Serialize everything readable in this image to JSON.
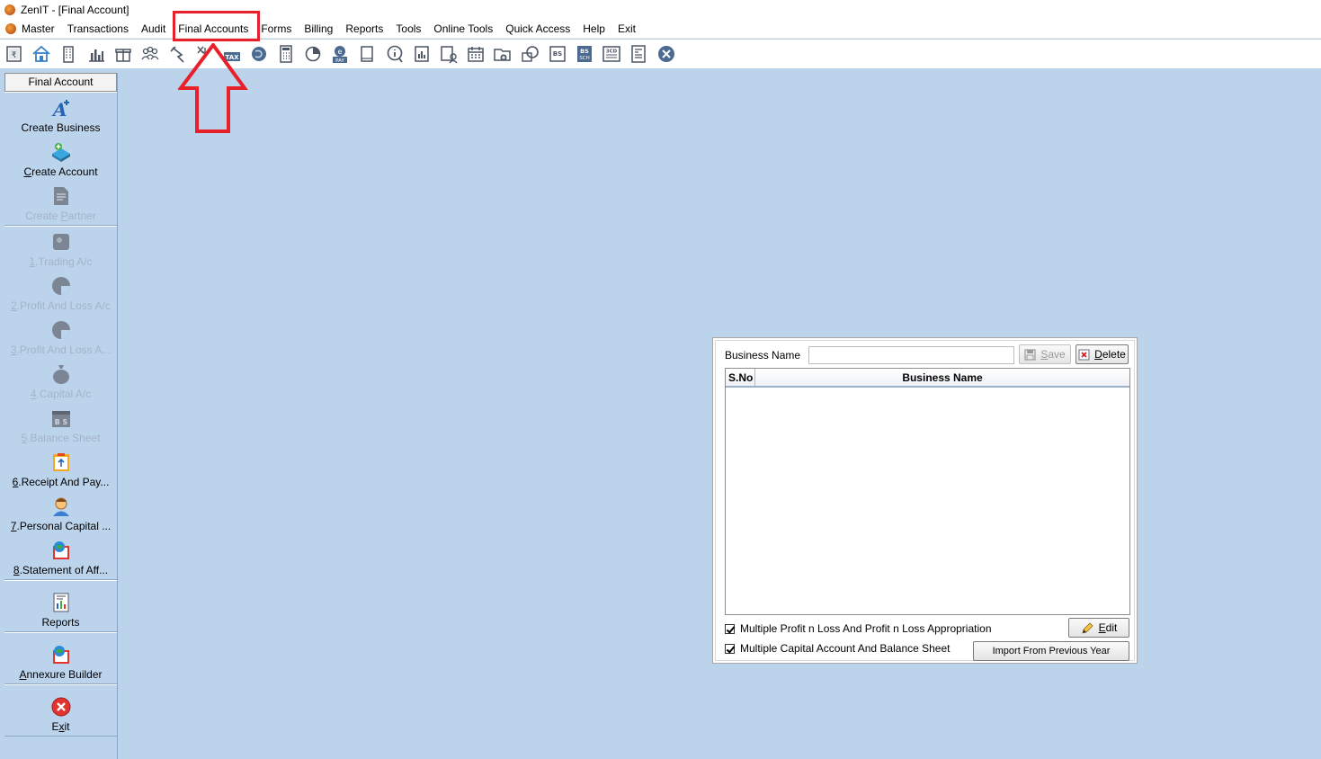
{
  "window": {
    "title": "ZenIT - [Final Account]"
  },
  "menu": {
    "items": [
      "Master",
      "Transactions",
      "Audit",
      "Final Accounts",
      "Forms",
      "Billing",
      "Reports",
      "Tools",
      "Online Tools",
      "Quick Access",
      "Help",
      "Exit"
    ],
    "highlighted": "Final Accounts"
  },
  "toolbar": {
    "icons": [
      "rupee-book-icon",
      "home-icon",
      "building-icon",
      "bar-chart-icon",
      "gift-icon",
      "group-icon",
      "pin-icon",
      "tax-icon",
      "tax-doc-icon",
      "audit-disc-icon",
      "calculator-icon",
      "pie-icon",
      "epay-icon",
      "book-icon",
      "info-icon",
      "report-icon",
      "user-report-icon",
      "calendar-icon",
      "folder-add-icon",
      "refresh-icon",
      "bs-icon",
      "bs-sch-icon",
      "3cd-icon",
      "form-icon",
      "close-circle-icon"
    ],
    "labels": {
      "tax": "TAX",
      "pay": "PAY",
      "bs": "BS",
      "sch": "SCH",
      "cd": "3CD"
    }
  },
  "sidebar": {
    "header": "Final Account",
    "groups": [
      [
        {
          "pre": "",
          "ul": "",
          "post": "Create Business",
          "icon": "create-business-icon",
          "enabled": true
        },
        {
          "pre": "",
          "ul": "C",
          "post": "reate Account",
          "icon": "create-account-icon",
          "enabled": true
        },
        {
          "pre": "Create ",
          "ul": "P",
          "post": "artner",
          "icon": "create-partner-icon",
          "enabled": false
        }
      ],
      [
        {
          "pre": "",
          "ul": "1",
          "post": ".Trading A/c",
          "icon": "trading-icon",
          "enabled": false
        },
        {
          "pre": "",
          "ul": "2",
          "post": ".Profit And Loss A/c",
          "icon": "profit-loss-icon",
          "enabled": false
        },
        {
          "pre": "",
          "ul": "3",
          "post": ".Profit And Loss A...",
          "icon": "profit-loss-appropriation-icon",
          "enabled": false
        },
        {
          "pre": "",
          "ul": "4",
          "post": ".Capital A/c",
          "icon": "capital-bag-icon",
          "enabled": false
        },
        {
          "pre": "",
          "ul": "5",
          "post": ".Balance Sheet",
          "icon": "balance-sheet-icon",
          "enabled": false
        },
        {
          "pre": "",
          "ul": "6",
          "post": ".Receipt And Pay...",
          "icon": "receipt-payment-icon",
          "enabled": true
        },
        {
          "pre": "",
          "ul": "7",
          "post": ".Personal Capital ...",
          "icon": "personal-capital-icon",
          "enabled": true
        },
        {
          "pre": "",
          "ul": "8",
          "post": ".Statement of Aff...",
          "icon": "statement-affairs-icon",
          "enabled": true
        }
      ],
      [
        {
          "pre": "",
          "ul": "",
          "post": "Reports",
          "icon": "reports-icon",
          "enabled": true
        }
      ],
      [
        {
          "pre": "",
          "ul": "A",
          "post": "nnexure Builder",
          "icon": "annexure-builder-icon",
          "enabled": true
        }
      ],
      [
        {
          "pre": "E",
          "ul": "x",
          "post": "it",
          "icon": "exit-icon",
          "enabled": true
        }
      ]
    ]
  },
  "panel": {
    "business_name_label": "Business Name",
    "business_name_value": "",
    "save": {
      "ul": "S",
      "post": "ave"
    },
    "delete": {
      "ul": "D",
      "post": "elete"
    },
    "table": {
      "headers": [
        "S.No",
        "Business Name"
      ],
      "rows": []
    },
    "checkbox1": {
      "label": "Multiple Profit n Loss And Profit n Loss Appropriation",
      "checked": true
    },
    "checkbox2": {
      "label": "Multiple Capital Account And Balance Sheet",
      "checked": true
    },
    "edit": {
      "ul": "E",
      "post": "dit"
    },
    "import_label": "Import From Previous Year"
  },
  "colors": {
    "background": "#bcd3ec",
    "highlight": "#e8202a"
  }
}
